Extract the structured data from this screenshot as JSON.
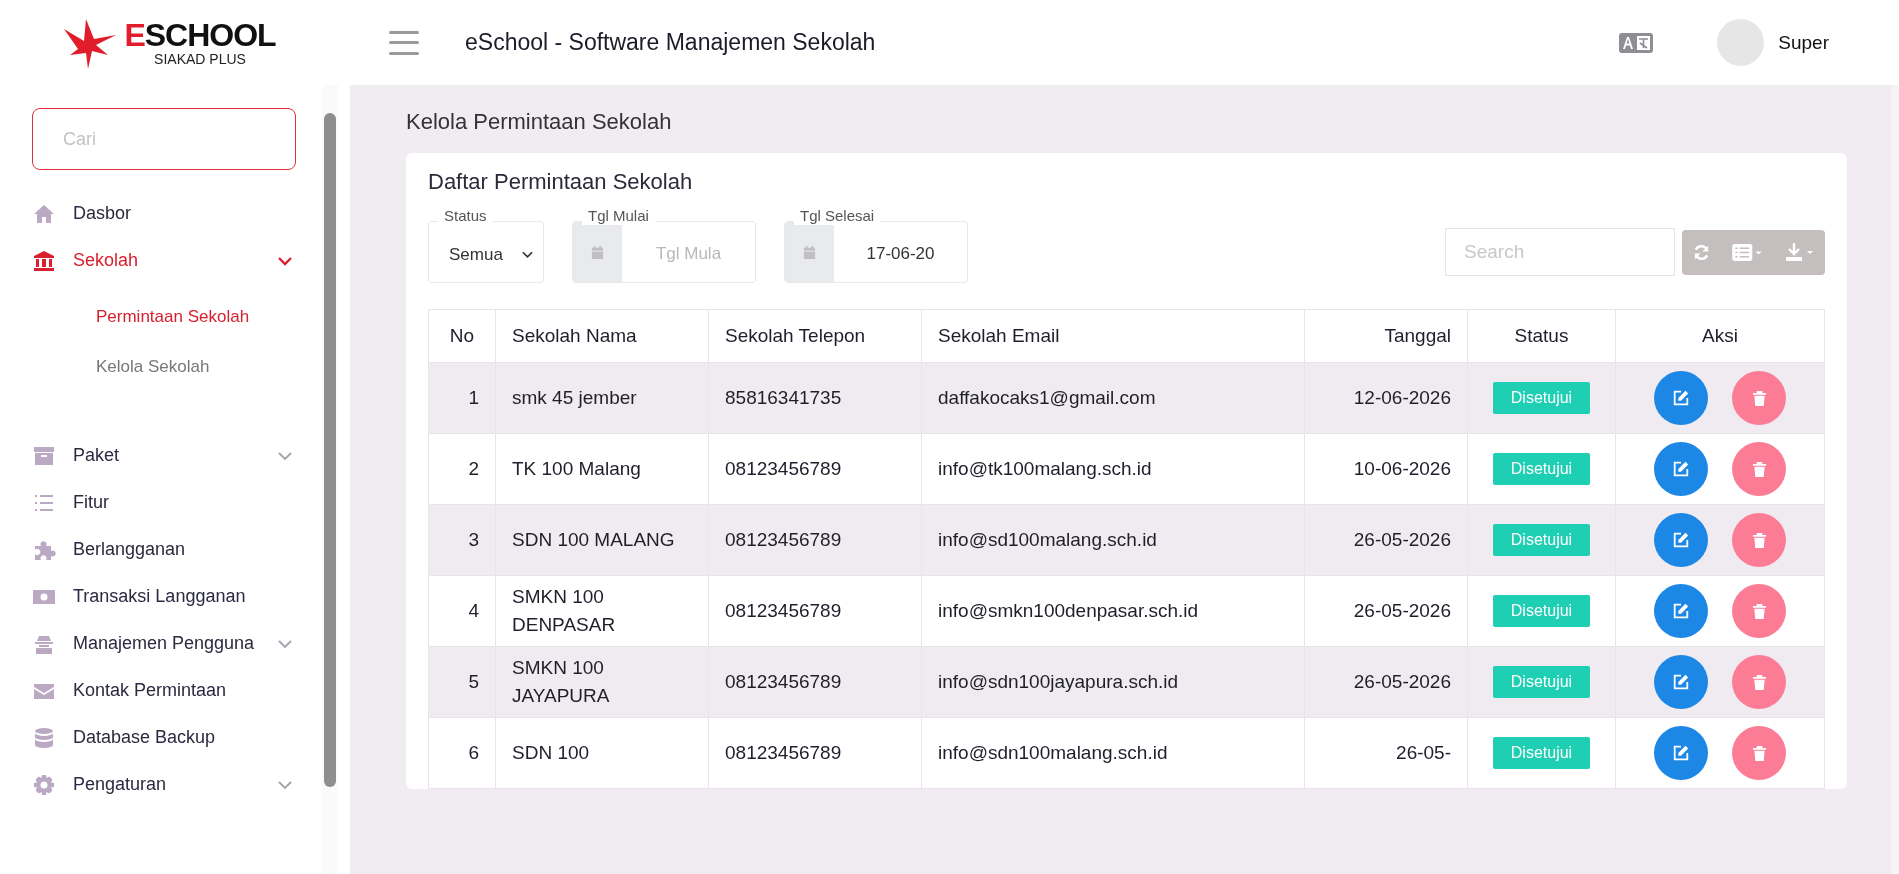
{
  "logo": {
    "title_first": "E",
    "title_rest": "SCHOOL",
    "subtitle": "SIAKAD PLUS"
  },
  "header": {
    "title": "eSchool - Software Manajemen Sekolah",
    "user": "Super"
  },
  "sidebar": {
    "search": {
      "placeholder": "Cari"
    },
    "items": [
      {
        "label": "Dasbor",
        "selected": false
      },
      {
        "label": "Sekolah",
        "selected": true,
        "expanded": true,
        "children": [
          {
            "label": "Permintaan Sekolah",
            "selected": true
          },
          {
            "label": "Kelola Sekolah",
            "selected": false
          }
        ]
      },
      {
        "label": "Paket",
        "selected": false,
        "expanded": false
      },
      {
        "label": "Fitur",
        "selected": false
      },
      {
        "label": "Berlangganan",
        "selected": false
      },
      {
        "label": "Transaksi Langganan",
        "selected": false
      },
      {
        "label": "Manajemen Pengguna",
        "selected": false,
        "expanded": false
      },
      {
        "label": "Kontak Permintaan",
        "selected": false
      },
      {
        "label": "Database Backup",
        "selected": false
      },
      {
        "label": "Pengaturan",
        "selected": false,
        "expanded": false
      }
    ]
  },
  "page_title": "Kelola Permintaan Sekolah",
  "card": {
    "title": "Daftar Permintaan Sekolah",
    "filters": {
      "status": {
        "label": "Status",
        "value": "Semua"
      },
      "start": {
        "label": "Tgl Mulai",
        "placeholder": "Tgl Mula"
      },
      "end": {
        "label": "Tgl Selesai",
        "value": "17-06-20"
      }
    },
    "search": {
      "placeholder": "Search"
    },
    "table": {
      "columns": [
        "No",
        "Sekolah Nama",
        "Sekolah Telepon",
        "Sekolah Email",
        "Tanggal",
        "Status",
        "Aksi"
      ],
      "rows": [
        {
          "no": "1",
          "name": "smk 45 jember",
          "phone": "85816341735",
          "email": "daffakocaks1@gmail.com",
          "date": "12-06-2026",
          "status": "Disetujui"
        },
        {
          "no": "2",
          "name": "TK 100 Malang",
          "phone": "08123456789",
          "email": "info@tk100malang.sch.id",
          "date": "10-06-2026",
          "status": "Disetujui"
        },
        {
          "no": "3",
          "name": "SDN 100 MALANG",
          "phone": "08123456789",
          "email": "info@sd100malang.sch.id",
          "date": "26-05-2026",
          "status": "Disetujui"
        },
        {
          "no": "4",
          "name": "SMKN 100 DENPASAR",
          "phone": "08123456789",
          "email": "info@smkn100denpasar.sch.id",
          "date": "26-05-2026",
          "status": "Disetujui"
        },
        {
          "no": "5",
          "name": "SMKN 100 JAYAPURA",
          "phone": "08123456789",
          "email": "info@sdn100jayapura.sch.id",
          "date": "26-05-2026",
          "status": "Disetujui"
        },
        {
          "no": "6",
          "name": "SDN 100",
          "phone": "08123456789",
          "email": "info@sdn100malang.sch.id",
          "date": "26-05-",
          "status": "Disetujui"
        }
      ]
    }
  }
}
